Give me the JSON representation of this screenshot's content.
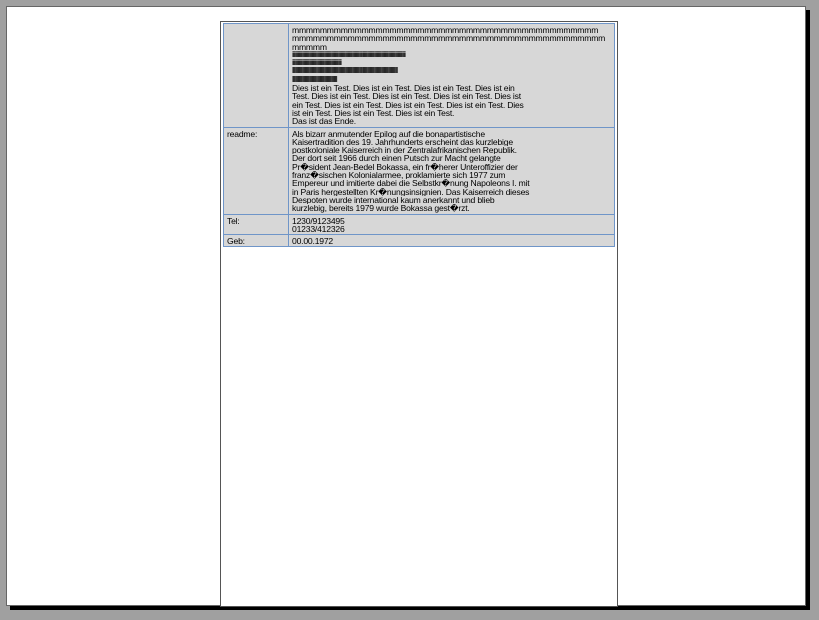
{
  "rows": [
    {
      "label": "",
      "lines": [
        "mmmmmmmmmmmmmmmmmmmmmmmmmmmmmmmmmmmmmmmmmmmm",
        "mmmmmmmmmmmmmmmmmmmmmmmmmmmmmmmmmmmmmmmmmmmmm",
        "mmmmm",
        "iiiiiiiiiiiiiiiiiiiiiiiiiiiiiiiiiiiiiiiiiiiiiiiiiiiiiiiiiiiiiiiiiiiiiiiiiiiiiiiiiiiiiiiiiiiiiiiiiiiiiiiiiiiiiiiiiiiiiiiiiiiiiiiii",
        "iiiiiiiiiiiiiiiiiiiiiiiiiiiiiiiiiiiiiiiiiiiiiiiiiiiiiiii",
        "llllllllllllllllllllllllllllllllllllllllllllllllllllllllllllllllllllllllllllllllllllllllllllllllllllllllllllllllllllllll",
        "lllllllllllllllllllllllllllllllllllllllllllllllllll",
        "Dies ist ein Test. Dies ist ein Test. Dies ist ein Test. Dies ist ein",
        "Test. Dies ist ein Test. Dies ist ein Test. Dies ist ein Test. Dies ist",
        "ein Test. Dies ist ein Test. Dies ist ein Test. Dies ist ein Test. Dies",
        "ist ein Test. Dies ist ein Test. Dies ist ein Test.",
        "Das ist das Ende."
      ]
    },
    {
      "label": "readme:",
      "lines": [
        "Als bizarr anmutender Epilog auf die bonapartistische",
        "Kaisertradition des 19. Jahrhunderts erscheint das kurzlebige",
        "postkoloniale Kaiserreich in der Zentralafrikanischen Republik.",
        "Der dort seit 1966 durch einen Putsch zur Macht gelangte",
        "Pr�sident Jean-Bedel Bokassa, ein fr�herer Unteroffizier der",
        "franz�sischen Kolonialarmee, proklamierte sich 1977 zum",
        "Empereur und imitierte dabei die Selbstkr�nung Napoleons I. mit",
        "in Paris hergestellten Kr�nungsinsignien. Das Kaiserreich dieses",
        "Despoten wurde international kaum anerkannt und blieb",
        "kurzlebig, bereits 1979 wurde Bokassa gest�rzt."
      ]
    },
    {
      "label": "Tel:",
      "lines": [
        "1230/9123495",
        "01233/412326"
      ]
    },
    {
      "label": "Geb:",
      "lines": [
        "00.00.1972"
      ]
    }
  ]
}
